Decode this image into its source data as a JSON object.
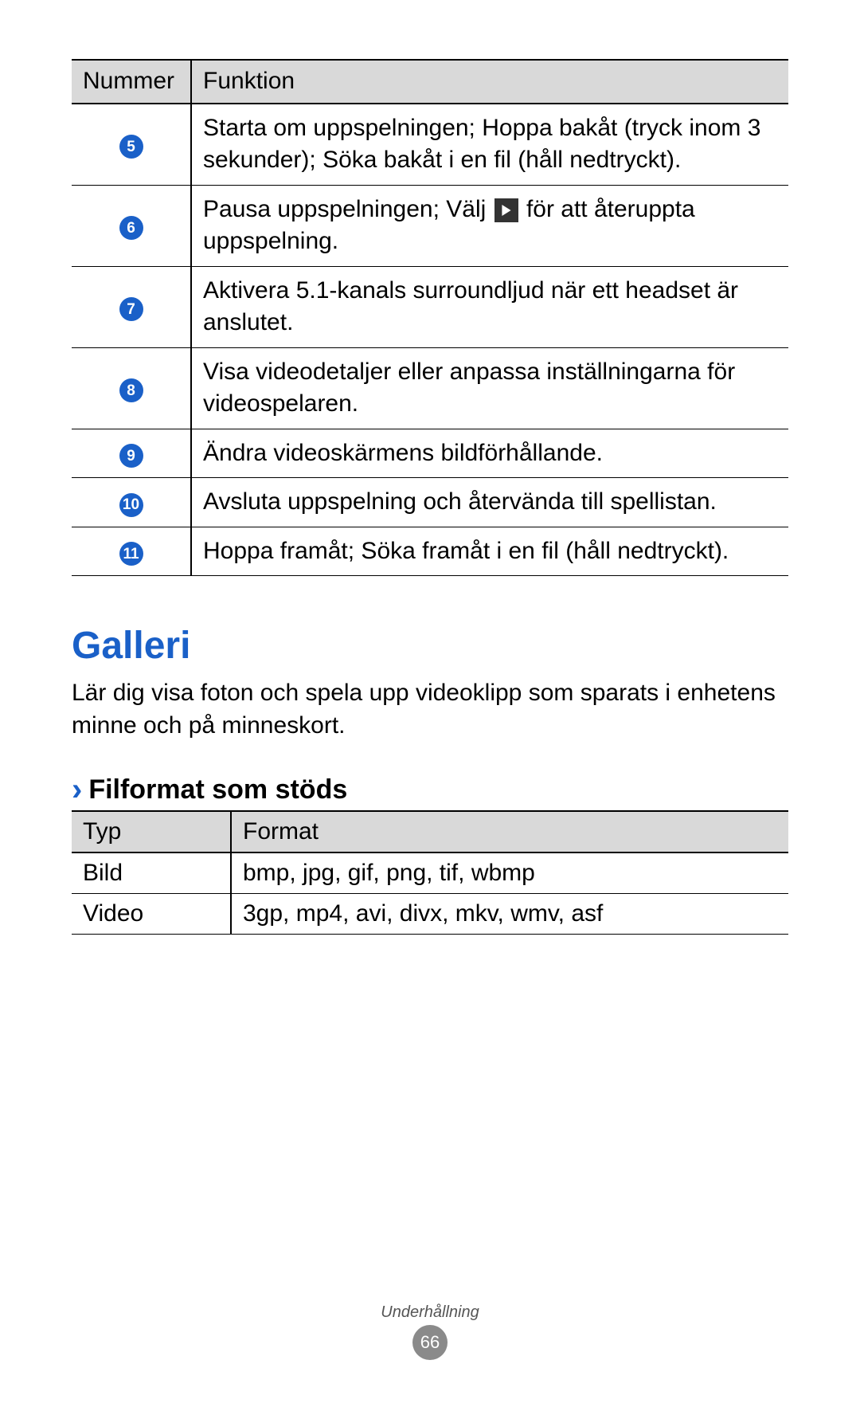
{
  "table1": {
    "headers": {
      "number": "Nummer",
      "function": "Funktion"
    },
    "rows": [
      {
        "num": "5",
        "text": "Starta om uppspelningen; Hoppa bakåt (tryck inom 3 sekunder); Söka bakåt i en fil (håll nedtryckt)."
      },
      {
        "num": "6",
        "text_before": "Pausa uppspelningen; Välj ",
        "text_after": " för att återuppta uppspelning."
      },
      {
        "num": "7",
        "text": "Aktivera 5.1-kanals surroundljud när ett headset är anslutet."
      },
      {
        "num": "8",
        "text": "Visa videodetaljer eller anpassa inställningarna för videospelaren."
      },
      {
        "num": "9",
        "text": "Ändra videoskärmens bildförhållande."
      },
      {
        "num": "10",
        "text": "Avsluta uppspelning och återvända till spellistan."
      },
      {
        "num": "11",
        "text": "Hoppa framåt; Söka framåt i en fil (håll nedtryckt)."
      }
    ]
  },
  "section": {
    "title": "Galleri",
    "intro": "Lär dig visa foton och spela upp videoklipp som sparats i enhetens minne och på minneskort."
  },
  "subsection": {
    "title": "Filformat som stöds"
  },
  "table2": {
    "headers": {
      "type": "Typ",
      "format": "Format"
    },
    "rows": [
      {
        "type": "Bild",
        "format": "bmp, jpg, gif, png, tif, wbmp"
      },
      {
        "type": "Video",
        "format": "3gp, mp4, avi, divx, mkv, wmv, asf"
      }
    ]
  },
  "footer": {
    "category": "Underhållning",
    "page": "66"
  }
}
